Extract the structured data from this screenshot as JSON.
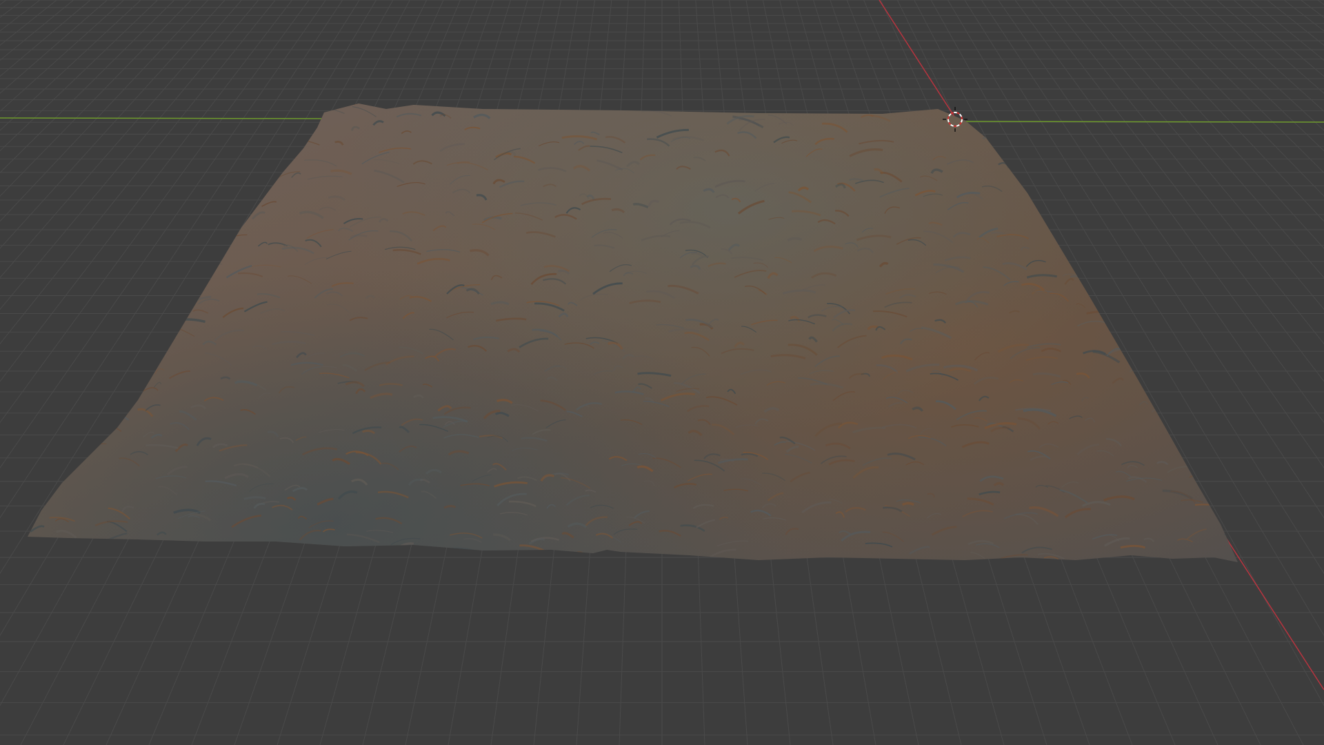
{
  "app": "3D viewport",
  "viewport": {
    "background": "#3d3d3d",
    "grid_color": "#4a4a4a",
    "x_axis_color": "#b8343f",
    "y_axis_color": "#6e9a2c",
    "cursor_colors": [
      "#ffffff",
      "#d63333"
    ],
    "terrain_colors": [
      "#5f5a55",
      "#6a4b35",
      "#3f4a4e",
      "#7a5436",
      "#545a5c"
    ],
    "object": "terrain-mesh",
    "icons": {
      "cursor": "3d-cursor-icon"
    }
  }
}
